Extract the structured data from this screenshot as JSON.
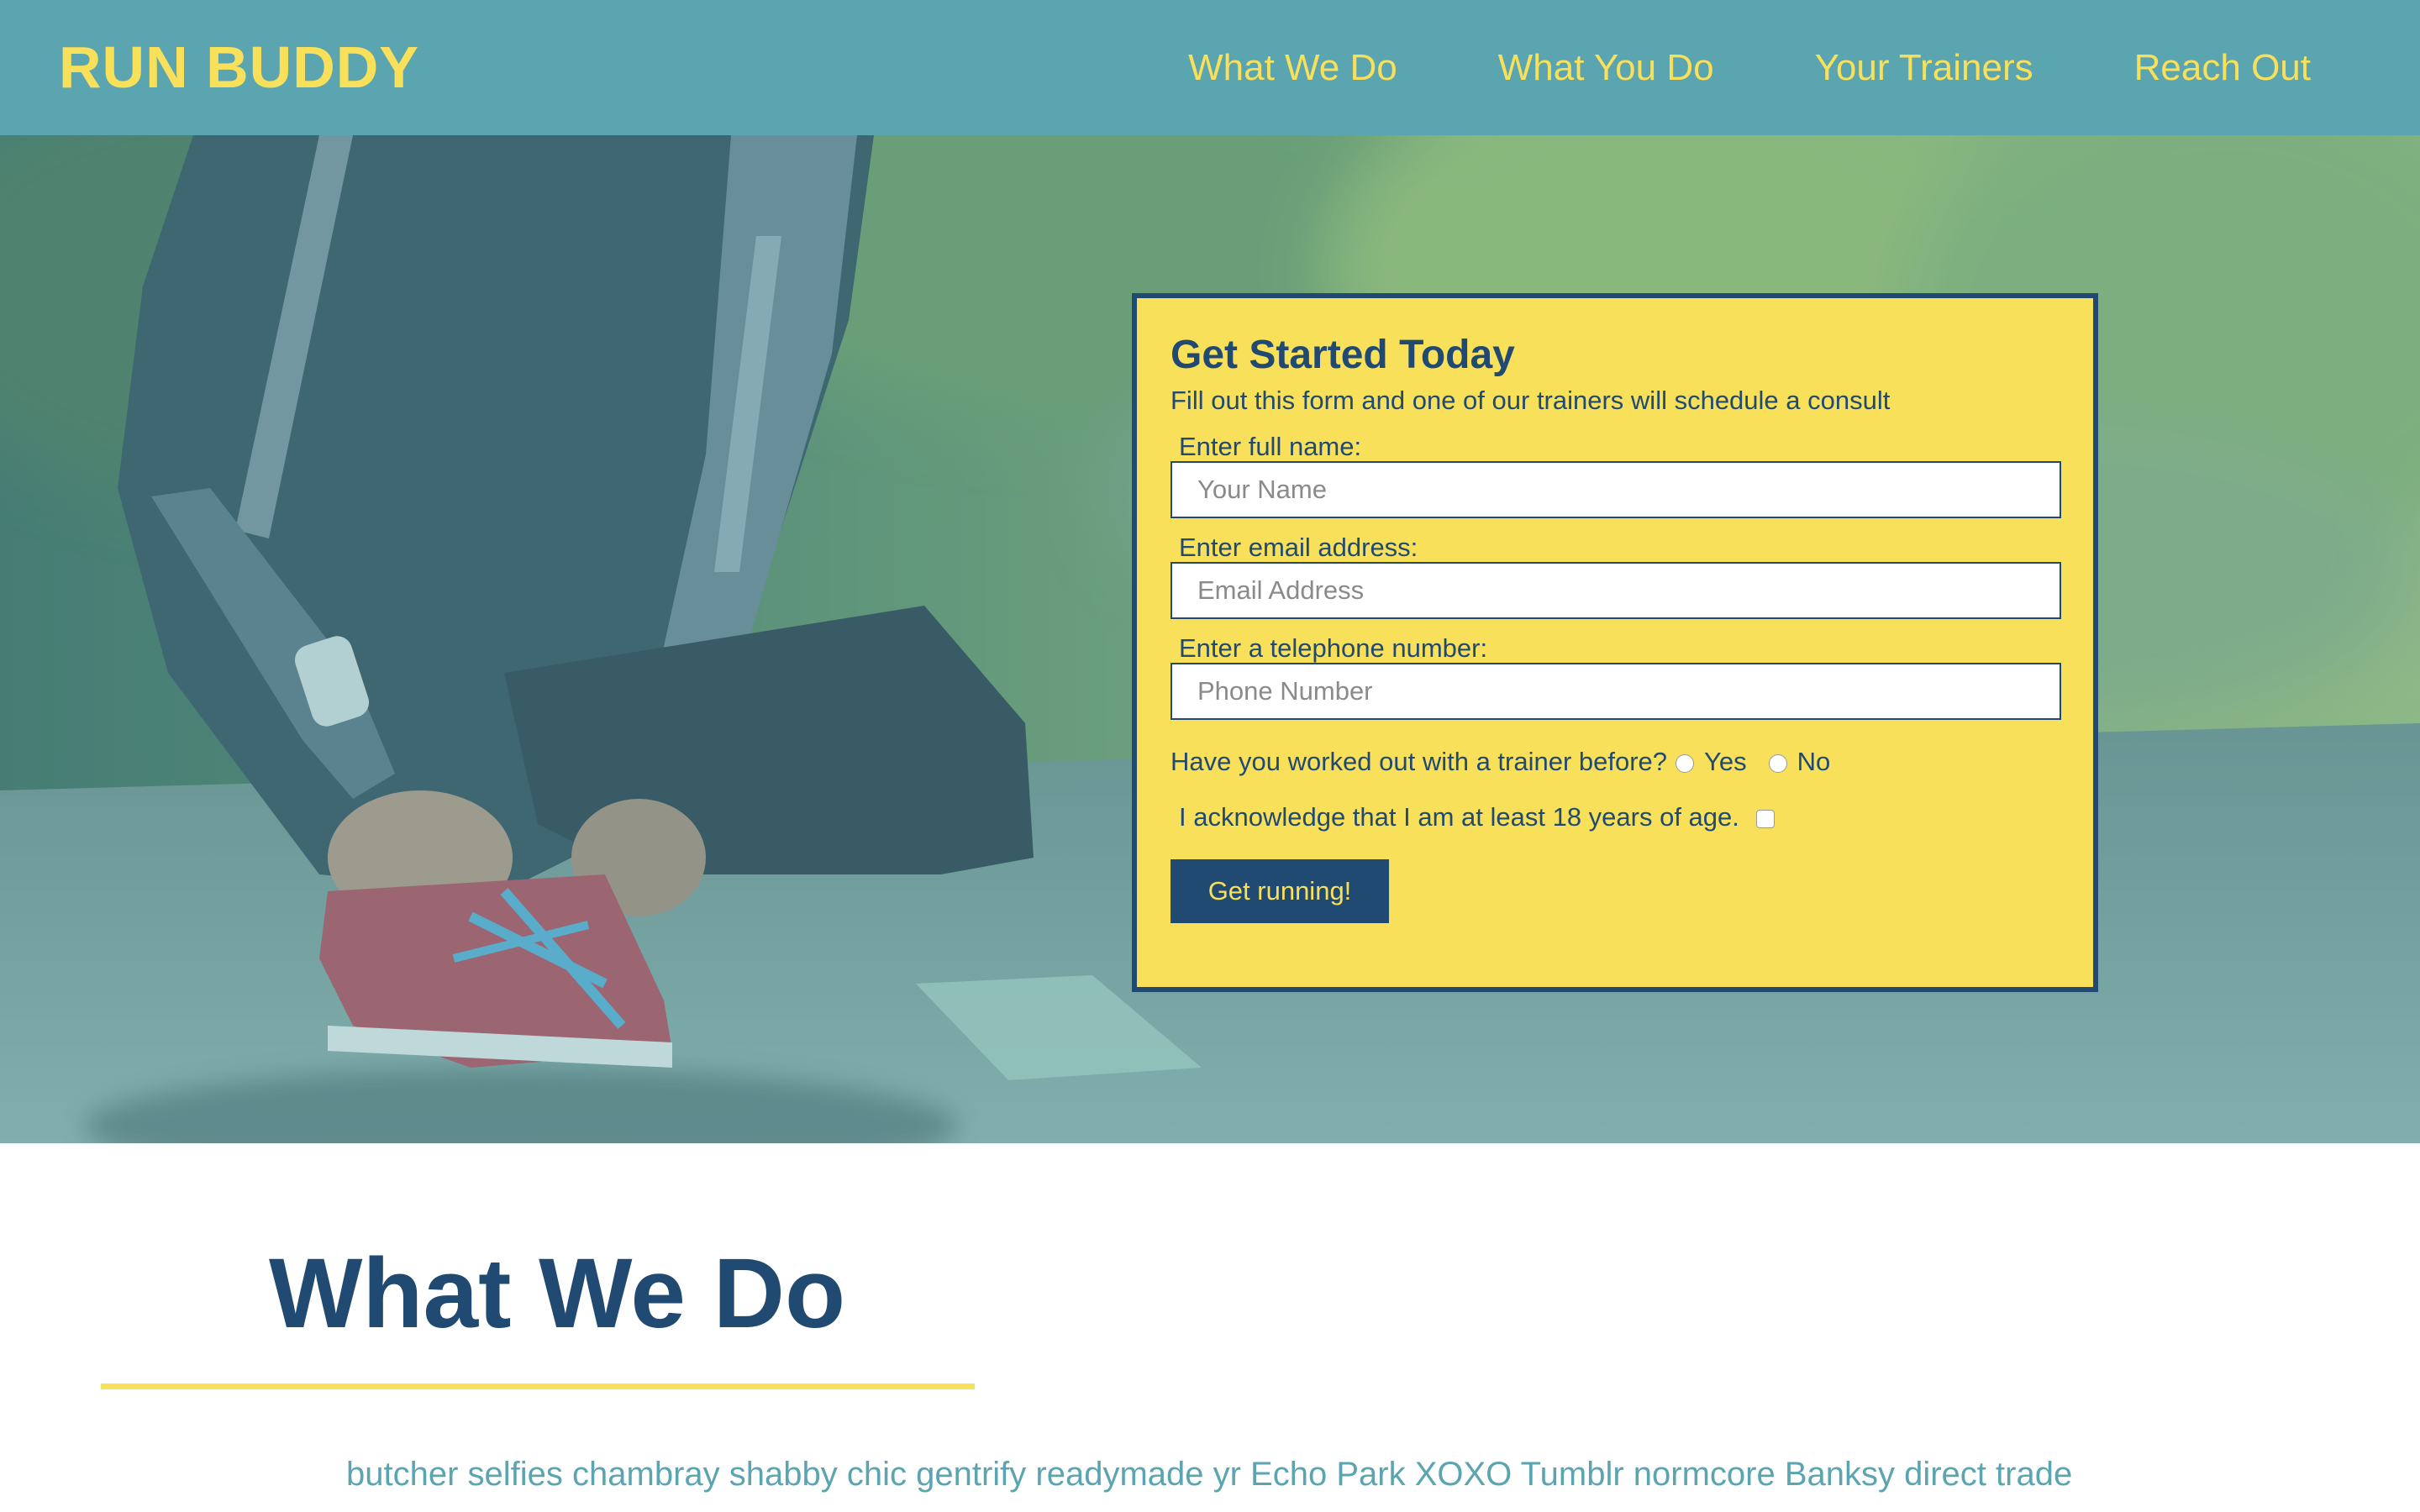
{
  "header": {
    "logo": "RUN BUDDY",
    "nav": [
      {
        "label": "What We Do"
      },
      {
        "label": "What You Do"
      },
      {
        "label": "Your Trainers"
      },
      {
        "label": "Reach Out"
      }
    ]
  },
  "hero": {
    "image": "runner-tying-shoe-photo"
  },
  "form": {
    "title": "Get Started Today",
    "subtitle": "Fill out this form and one of our trainers will schedule a consult",
    "name_label": "Enter full name:",
    "name_placeholder": "Your Name",
    "email_label": "Enter email address:",
    "email_placeholder": "Email Address",
    "phone_label": "Enter a telephone number:",
    "phone_placeholder": "Phone Number",
    "trainer_question": "Have you worked out with a trainer before?",
    "yes_label": "Yes",
    "no_label": "No",
    "age_ack": "I acknowledge that I am at least 18 years of age.",
    "submit_label": "Get running!"
  },
  "section": {
    "title": "What We Do",
    "text": "butcher selfies chambray shabby chic gentrify readymade yr Echo Park XOXO Tumblr normcore Banksy direct trade"
  },
  "colors": {
    "header_bg": "#5ba5b1",
    "accent_yellow": "#f9e05a",
    "navy": "#214a72"
  }
}
